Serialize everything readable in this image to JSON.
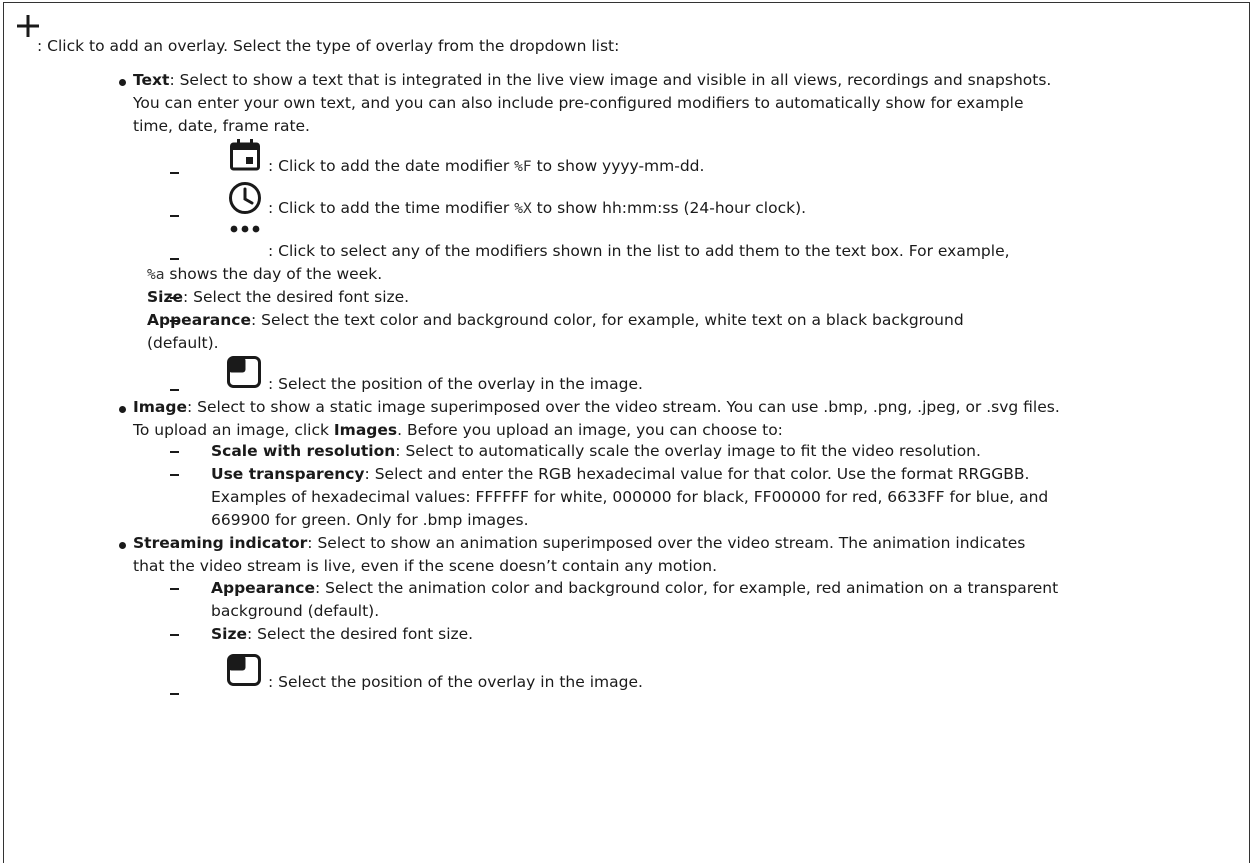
{
  "intro": {
    "icon": "plus-icon",
    "text": ": Click to add an overlay. Select the type of overlay from the dropdown list:"
  },
  "text_item": {
    "label": "Text",
    "line1": ": Select to show a text that is integrated in the live view image and visible in all views, recordings and snapshots.",
    "line2": "You can enter your own text, and you can also include pre-configured modifiers to automatically show for example",
    "line3": "time, date, frame rate.",
    "sub": {
      "date": {
        "icon": "calendar-icon",
        "pre": ": Click to add the date modifier ",
        "code": "%F",
        "post": " to show yyyy-mm-dd."
      },
      "time": {
        "icon": "clock-icon",
        "pre": ": Click to add the time modifier ",
        "code": "%X",
        "post": " to show hh:mm:ss (24-hour clock)."
      },
      "more": {
        "icon": "more-horizontal-icon",
        "line1": ": Click to select any of the modifiers shown in the list to add them to the text box. For example,",
        "code": "%a",
        "line2_post": " shows the day of the week."
      },
      "size": {
        "label": "Size",
        "text": ": Select the desired font size."
      },
      "appearance": {
        "label": "Appearance",
        "line1": ": Select the text color and background color, for example, white text on a black background",
        "line2": "(default)."
      },
      "position": {
        "icon": "position-icon",
        "text": ": Select the position of the overlay in the image."
      }
    }
  },
  "image_item": {
    "label": "Image",
    "line1": ": Select to show a static image superimposed over the video stream. You can use .bmp, .png, .jpeg, or .svg files.",
    "line2_pre": "To upload an image, click ",
    "line2_bold": "Images",
    "line2_post": ". Before you upload an image, you can choose to:",
    "sub": {
      "scale": {
        "label": "Scale with resolution",
        "text": ": Select to automatically scale the overlay image to fit the video resolution."
      },
      "transparency": {
        "label": "Use transparency",
        "line1": ": Select and enter the RGB hexadecimal value for that color. Use the format RRGGBB.",
        "line2": "Examples of hexadecimal values: FFFFFF for white, 000000 for black, FF00000 for red, 6633FF for blue, and",
        "line3": "669900 for green. Only for .bmp images."
      }
    }
  },
  "streaming_item": {
    "label": "Streaming indicator",
    "line1": ": Select to show an animation superimposed over the video stream. The animation indicates",
    "line2": "that the video stream is live, even if the scene doesn’t contain any motion.",
    "sub": {
      "appearance": {
        "label": "Appearance",
        "line1": ": Select the animation color and background color, for example, red animation on a transparent",
        "line2": "background (default)."
      },
      "size": {
        "label": "Size",
        "text": ": Select the desired font size."
      },
      "position": {
        "icon": "position-icon",
        "text": ": Select the position of the overlay in the image."
      }
    }
  }
}
